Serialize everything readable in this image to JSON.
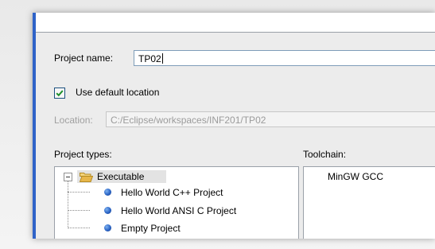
{
  "project": {
    "name_label": "Project name:",
    "name_value": "TP02"
  },
  "location": {
    "use_default_label": "Use default location",
    "use_default_checked": true,
    "label": "Location:",
    "value": "C:/Eclipse/workspaces/INF201/TP02"
  },
  "project_types": {
    "label": "Project types:",
    "category": "Executable",
    "items": [
      "Hello World C++ Project",
      "Hello World ANSI C Project",
      "Empty Project"
    ]
  },
  "toolchain": {
    "label": "Toolchain:",
    "items": [
      "MinGW GCC"
    ]
  },
  "colors": {
    "accent": "#2f63c8",
    "checkmark": "#1d8f2a",
    "folder": "#e7b64a"
  }
}
